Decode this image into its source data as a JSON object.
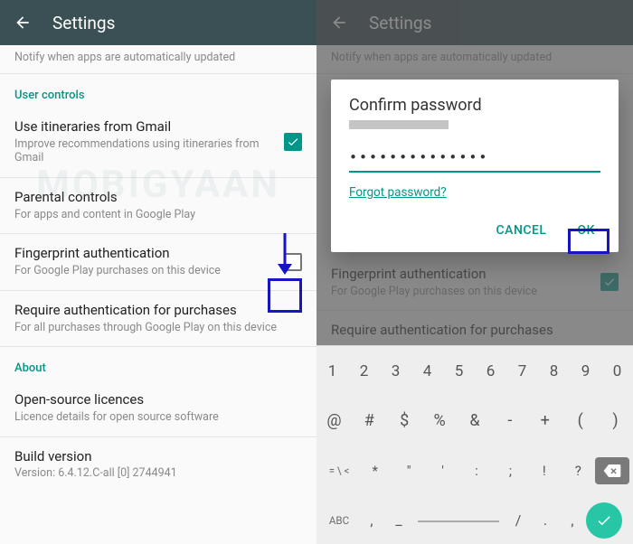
{
  "watermark": "MOBIGYAAN",
  "appbar_title": "Settings",
  "left": {
    "notify_sub": "Notify when apps are automatically updated",
    "header_user_controls": "User controls",
    "use_itineraries": {
      "title": "Use itineraries from Gmail",
      "sub": "Improve recommendations using itineraries from Gmail",
      "checked": true
    },
    "parental": {
      "title": "Parental controls",
      "sub": "For apps and content in Google Play"
    },
    "fingerprint": {
      "title": "Fingerprint authentication",
      "sub": "For Google Play purchases on this device",
      "checked": false
    },
    "require_auth": {
      "title": "Require authentication for purchases",
      "sub": "For all purchases through Google Play on this device"
    },
    "header_about": "About",
    "oss": {
      "title": "Open-source licences",
      "sub": "Licence details for open source software"
    },
    "build": {
      "title": "Build version",
      "sub": "Version: 6.4.12.C-all [0] 2744941"
    }
  },
  "right": {
    "notify_sub": "Notify when apps are automatically updated",
    "fingerprint": {
      "title": "Fingerprint authentication",
      "sub": "For Google Play purchases on this device",
      "checked": true
    },
    "require_auth_title": "Require authentication for purchases",
    "dialog": {
      "title": "Confirm password",
      "password_mask": "••••••••••••••",
      "forgot": "Forgot password?",
      "cancel": "CANCEL",
      "ok": "OK"
    }
  },
  "keyboard": {
    "row1": [
      "1",
      "2",
      "3",
      "4",
      "5",
      "6",
      "7",
      "8",
      "9",
      "0"
    ],
    "row2": [
      "@",
      "#",
      "$",
      "%",
      "&",
      "-",
      "+",
      "(",
      ")"
    ],
    "row3_left": "= \\ <",
    "row3": [
      "*",
      "\"",
      "'",
      ":",
      ";",
      "!",
      "?"
    ],
    "row4_left": "ABC",
    "row4": [
      ",",
      "_",
      "",
      "/",
      ".",
      ","
    ]
  }
}
